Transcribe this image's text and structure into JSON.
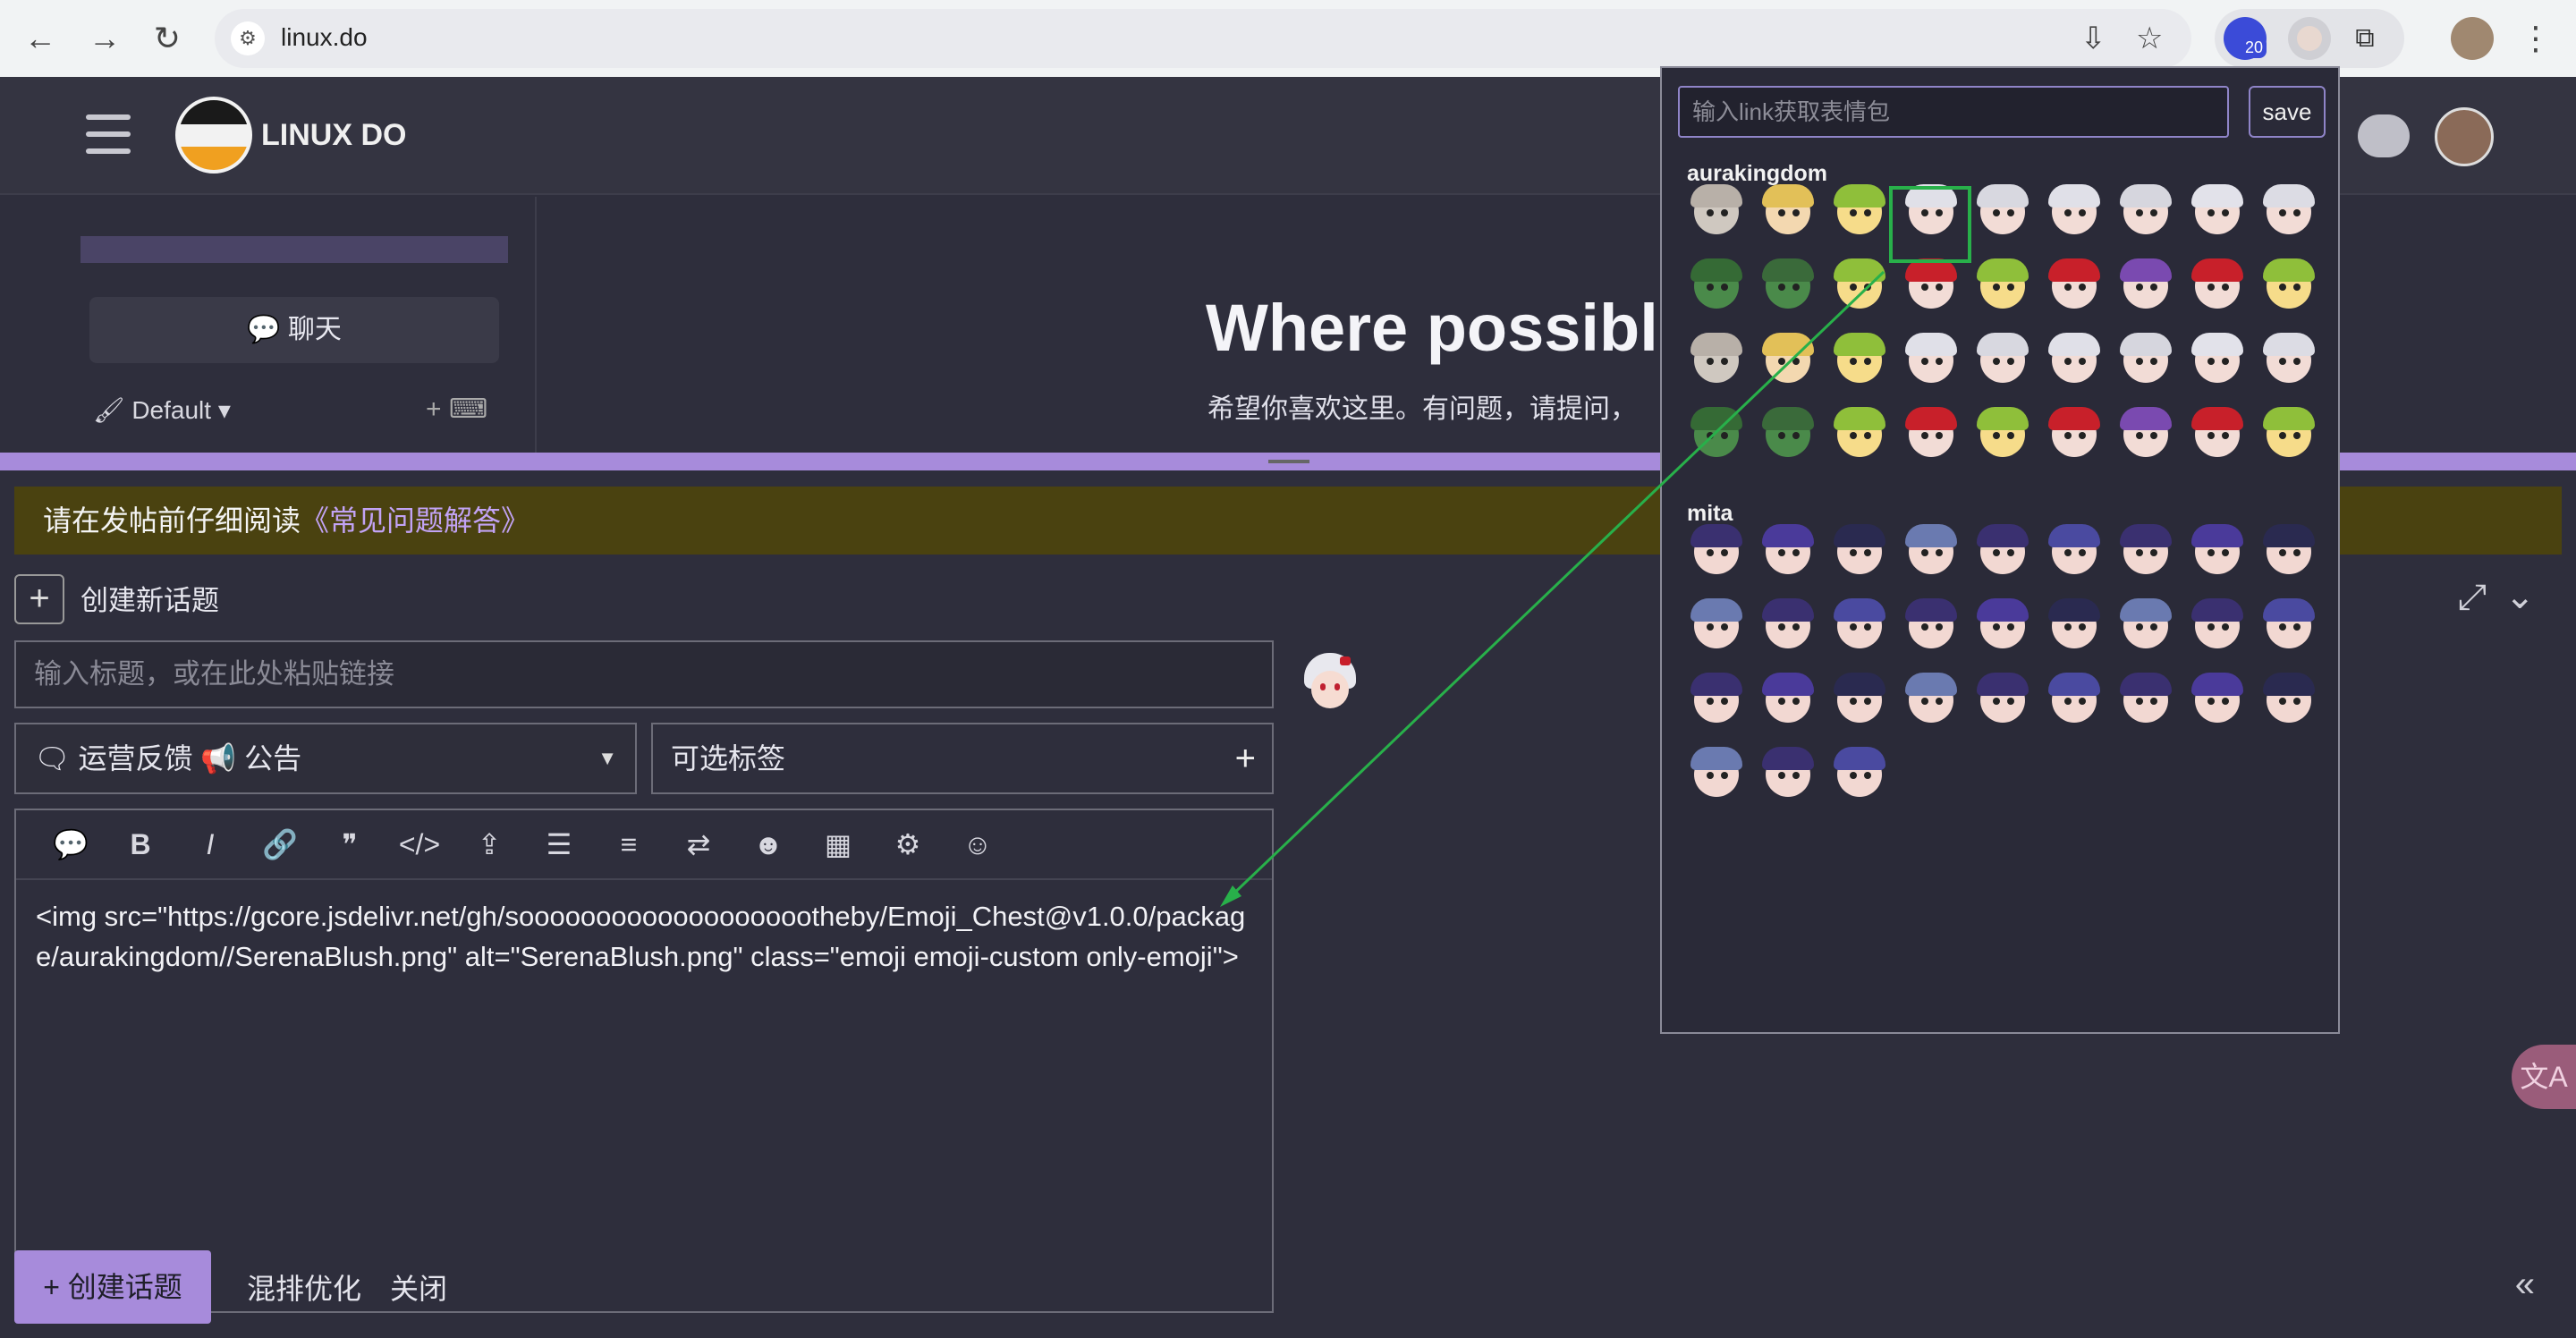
{
  "browser": {
    "url": "linux.do",
    "ext_badge": "20",
    "back_icon": "←",
    "forward_icon": "→",
    "reload_icon": "↻",
    "site_info_icon": "⚙",
    "install_icon": "⇩",
    "star_icon": "☆",
    "puzzle_icon": "⧉",
    "menu_icon": "⋮"
  },
  "site": {
    "brand": "LINUX DO",
    "sidebar": {
      "chat": "💬 聊天",
      "default": "🖌 Default ▾",
      "icons": "+ ⌨"
    },
    "hero_title": "Where possible",
    "hero_sub": "希望你喜欢这里。有问题，请提问，",
    "notice_prefix": "请在发帖前仔细阅读",
    "notice_link": "《常见问题解答》",
    "new_topic": "创建新话题",
    "title_placeholder": "输入标题，或在此处粘贴链接",
    "category": "🗨 运营反馈  📢 公告",
    "tags_placeholder": "可选标签",
    "editor_content": "<img src=\"https://gcore.jsdelivr.net/gh/soooooooooooooooooootheby/Emoji_Chest@v1.0.0/package/aurakingdom//SerenaBlush.png\" alt=\"SerenaBlush.png\" class=\"emoji emoji-custom only-emoji\">",
    "toolbar": [
      "💬",
      "B",
      "I",
      "🔗",
      "❞",
      "</>",
      "⇪",
      "☰",
      "≡",
      "⇄",
      "☻",
      "▦",
      "⚙",
      "☺"
    ],
    "create_button": "+ 创建话题",
    "mix_optimize": "混排优化",
    "close": "关闭",
    "expand_icon": "⤢",
    "collapse_icon": "⌄",
    "double_left_icon": "«",
    "translate_icon": "文A"
  },
  "popup": {
    "placeholder": "输入link获取表情包",
    "save": "save",
    "sections": [
      {
        "name": "aurakingdom",
        "count": 36
      },
      {
        "name": "mita",
        "count": 30
      }
    ]
  },
  "colors": {
    "accent": "#a78bdb",
    "notice_bg": "#4a4210",
    "selection": "#28b04a"
  }
}
